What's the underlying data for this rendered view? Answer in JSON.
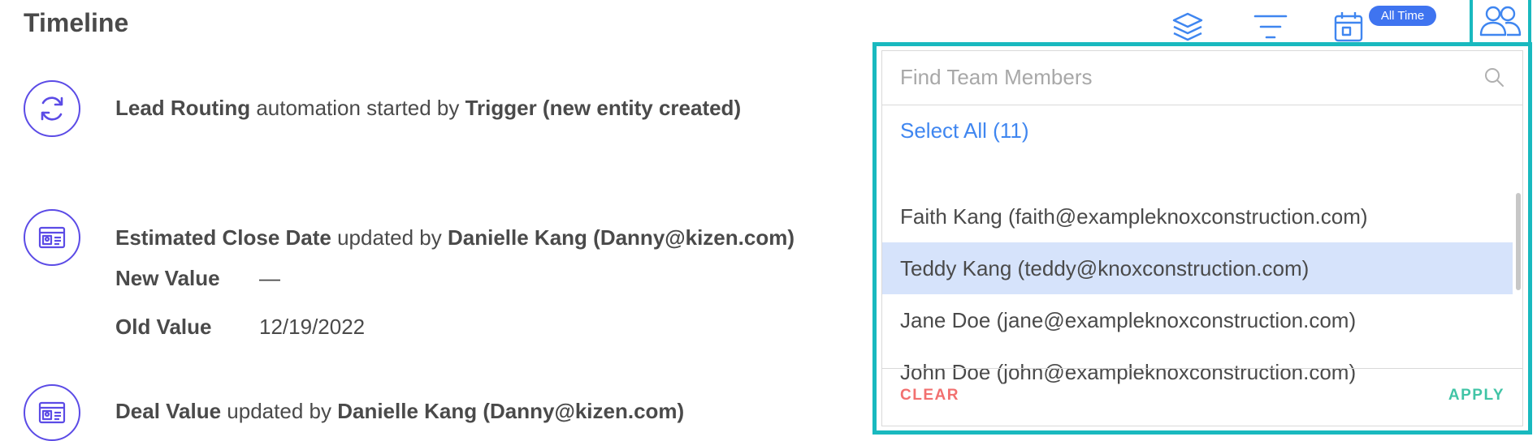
{
  "page": {
    "title": "Timeline"
  },
  "toolbar": {
    "date_badge": "All Time"
  },
  "timeline": {
    "event1": {
      "field": "Lead Routing",
      "verb": " automation started by ",
      "actor": "Trigger (new entity created)"
    },
    "event2": {
      "field": "Estimated Close Date",
      "verb": " updated by ",
      "actor": "Danielle Kang (Danny@kizen.com)",
      "new_label": "New Value",
      "new_value": "—",
      "old_label": "Old Value",
      "old_value": "12/19/2022"
    },
    "event3": {
      "field": "Deal Value",
      "verb": " updated by ",
      "actor": "Danielle Kang (Danny@kizen.com)"
    }
  },
  "team_filter": {
    "search_placeholder": "Find Team Members",
    "search_value": "",
    "select_all": "Select All (11)",
    "members": [
      {
        "label": "Faith Kang (faith@exampleknoxconstruction.com)",
        "selected": false
      },
      {
        "label": "Teddy Kang (teddy@knoxconstruction.com)",
        "selected": true
      },
      {
        "label": "Jane Doe (jane@exampleknoxconstruction.com)",
        "selected": false
      },
      {
        "label": "John Doe (john@exampleknoxconstruction.com)",
        "selected": false
      }
    ],
    "clear_label": "CLEAR",
    "apply_label": "APPLY"
  },
  "colors": {
    "accent": "#5b4be6",
    "highlight_border": "#19b9bf",
    "link_blue": "#3f86f0",
    "selected_row": "#d6e3fb",
    "clear_red": "#f2706f",
    "apply_green": "#41c4a6"
  },
  "icons": {
    "event1": "refresh-icon",
    "event2": "id-card-icon",
    "event3": "id-card-icon",
    "toolbar": [
      "layers-icon",
      "filter-icon",
      "calendar-icon",
      "team-members-icon"
    ]
  }
}
